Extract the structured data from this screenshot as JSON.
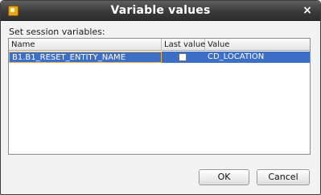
{
  "window": {
    "title": "Variable values",
    "close_symbol": "×",
    "icon": "app-icon"
  },
  "section": {
    "label": "Set session variables:"
  },
  "table": {
    "columns": [
      "Name",
      "Last value",
      "Value"
    ],
    "rows": [
      {
        "name": "B1.B1_RESET_ENTITY_NAME",
        "last_value_checked": false,
        "value": "CD_LOCATION",
        "selected": true
      }
    ]
  },
  "buttons": {
    "ok": "OK",
    "cancel": "Cancel"
  },
  "colors": {
    "selection": "#3d6fc6",
    "titlebar": "#3b3b3b",
    "focus_border": "#e7b24a"
  }
}
